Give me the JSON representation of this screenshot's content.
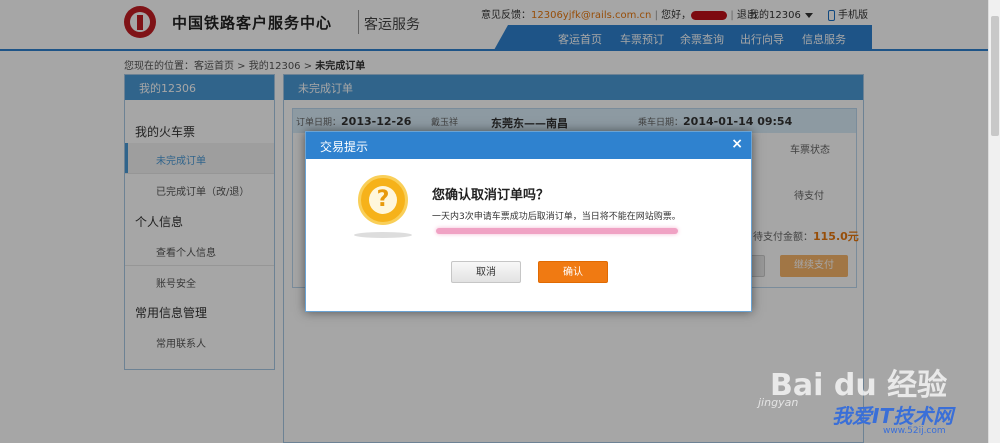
{
  "header": {
    "brand": "中国铁路客户服务中心",
    "sub": "客运服务",
    "feedback_label": "意见反馈：",
    "feedback_email": "12306yjfk@rails.com.cn",
    "greeting": "您好，",
    "logout": "退出",
    "my12306": "我的12306",
    "mobile": "手机版",
    "nav": [
      "客运首页",
      "车票预订",
      "余票查询",
      "出行向导",
      "信息服务"
    ]
  },
  "breadcrumb": {
    "prefix": "您现在的位置：客运首页 > 我的12306 > ",
    "current": "未完成订单"
  },
  "sidebar": {
    "title": "我的12306",
    "groups": [
      "我的火车票",
      "个人信息",
      "常用信息管理"
    ],
    "items": [
      "未完成订单",
      "已完成订单（改/退）",
      "查看个人信息",
      "账号安全",
      "常用联系人"
    ]
  },
  "main": {
    "title": "未完成订单",
    "order_date_label": "订单日期：",
    "order_date": "2013-12-26",
    "passenger": "戴玉祥",
    "route": "东莞东——南昌",
    "depart_label": "乘车日期：",
    "depart": "2014-01-14 09:54",
    "col_status": "车票状态",
    "status_value": "待支付",
    "total_label": "待支付金额：",
    "total_value": "115.0元",
    "pay_button": "继续支付"
  },
  "dialog": {
    "title": "交易提示",
    "close": "×",
    "question": "您确认取消订单吗？",
    "message": "一天内3次申请车票成功后取消订单，当日将不能在网站购票。",
    "cancel": "取消",
    "confirm": "确认"
  },
  "watermark": {
    "baidu": "Bai du 经验",
    "url": "jingyan",
    "site": "我爱IT技术网",
    "site_url": "www.52ij.com"
  },
  "colors": {
    "nav_blue": "#2f82cf",
    "confirm_orange": "#f07a12",
    "price_orange": "#e8780e"
  }
}
